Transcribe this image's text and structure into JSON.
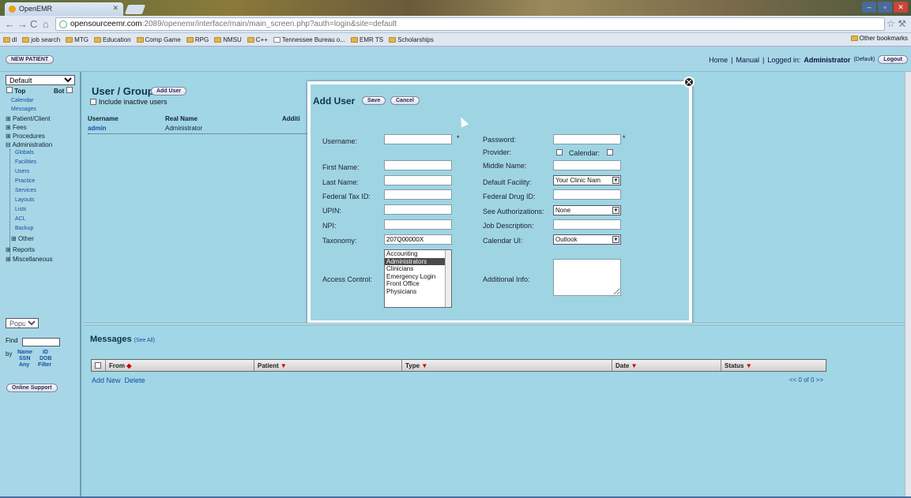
{
  "browser": {
    "tab_title": "OpenEMR",
    "url_host": "opensourceemr.com",
    "url_rest": ":2089/openemr/interface/main/main_screen.php?auth=login&site=default",
    "bookmarks": [
      "dl",
      "job search",
      "MTG",
      "Education",
      "Comp Game",
      "RPG",
      "NMSU",
      "C++",
      "Tennessee Bureau o...",
      "EMR TS",
      "Scholarships"
    ],
    "other_bookmarks": "Other bookmarks"
  },
  "appbar": {
    "new_patient": "NEW PATIENT",
    "home": "Home",
    "sep1": "|",
    "manual": "Manual",
    "sep2": "|",
    "logged_in_label": "Logged in:",
    "user": "Administrator",
    "user_suffix": "(Default)",
    "logout": "Logout"
  },
  "leftnav": {
    "selector": "Default",
    "top_label": "Top",
    "bot_label": "Bot",
    "items": {
      "calendar": "Calendar",
      "messages": "Messages",
      "patient_client": "Patient/Client",
      "fees": "Fees",
      "procedures": "Procedures",
      "administration": "Administration",
      "globals": "Globals",
      "facilities": "Facilities",
      "users": "Users",
      "practice": "Practice",
      "services": "Services",
      "layouts": "Layouts",
      "lists": "Lists",
      "acl": "ACL",
      "backup": "Backup",
      "other": "Other",
      "reports": "Reports",
      "miscellaneous": "Miscellaneous"
    },
    "popups": "Popups",
    "find_label": "Find",
    "by_label": "by",
    "by_name": "Name",
    "by_id": "ID",
    "by_ssn": "SSN",
    "by_dob": "DOB",
    "by_any": "Any",
    "by_filter": "Filter",
    "online_support": "Online Support"
  },
  "users_panel": {
    "title": "User / Groups",
    "add_user_button": "Add User",
    "include_inactive": "Include inactive users",
    "columns": [
      "Username",
      "Real Name",
      "Additi"
    ],
    "rows": [
      {
        "username": "admin",
        "realname": "Administrator"
      }
    ]
  },
  "dialog": {
    "title": "Add User",
    "save": "Save",
    "cancel": "Cancel",
    "close": "✕",
    "username_label": "Username:",
    "password_label": "Password:",
    "provider_label": "Provider:",
    "calendar_label": "Calendar:",
    "first_name_label": "First Name:",
    "middle_name_label": "Middle Name:",
    "last_name_label": "Last Name:",
    "default_facility_label": "Default Facility:",
    "default_facility_value": "Your Clinic Nam",
    "federal_tax_label": "Federal Tax ID:",
    "federal_drug_label": "Federal Drug ID:",
    "upin_label": "UPIN:",
    "see_auth_label": "See Authorizations:",
    "see_auth_value": "None",
    "npi_label": "NPI:",
    "job_desc_label": "Job Description:",
    "taxonomy_label": "Taxonomy:",
    "taxonomy_value": "207Q00000X",
    "calendar_ui_label": "Calendar UI:",
    "calendar_ui_value": "Outlook",
    "access_control_label": "Access Control:",
    "access_options": [
      "Accounting",
      "Administrators",
      "Clinicians",
      "Emergency Login",
      "Front Office",
      "Physicians"
    ],
    "access_selected": "Administrators",
    "additional_info_label": "Additional Info:",
    "required_mark": "*"
  },
  "messages": {
    "title": "Messages",
    "see_all": "(See All)",
    "columns": [
      "From",
      "Patient",
      "Type",
      "Date",
      "Status"
    ],
    "add_new": "Add New",
    "delete": "Delete",
    "pager": "<<  0 of 0  >>"
  }
}
